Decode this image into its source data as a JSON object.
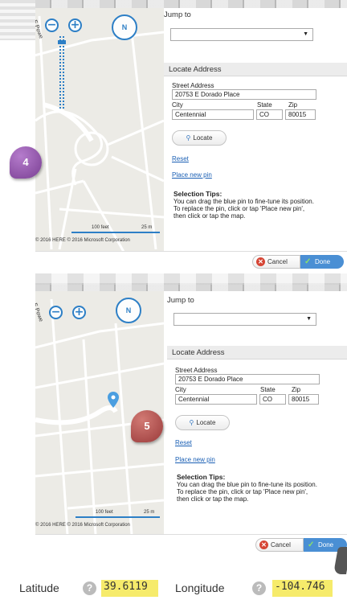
{
  "panel": {
    "jump_to": "Jump to",
    "locate_address": "Locate Address",
    "street_label": "Street Address",
    "street_value": "20753 E Dorado Place",
    "city_label": "City",
    "city_value": "Centennial",
    "state_label": "State",
    "state_value": "CO",
    "zip_label": "Zip",
    "zip_value": "80015",
    "locate_button": "Locate",
    "reset_link": "Reset",
    "place_pin_link": "Place new pin",
    "tips_title": "Selection Tips:",
    "tips_text": "You can drag the blue pin to fine-tune its position. To replace the pin, click or tap 'Place new pin', then click or tap the map.",
    "cancel_button": "Cancel",
    "done_button": "Done"
  },
  "map": {
    "compass_label": "N",
    "zoom_in": "+",
    "zoom_out": "−",
    "scale_feet": "100 feet",
    "scale_m": "25 m",
    "copyright": "© 2016 HERE  © 2016 Microsoft Corporation",
    "street_fragment": "E Powe"
  },
  "steps": {
    "step4": "4",
    "step5": "5",
    "step4_color": "#8a4fa0",
    "step5_color": "#b24a4a"
  },
  "coords": {
    "latitude_label": "Latitude",
    "latitude_value": "39.6119",
    "longitude_label": "Longitude",
    "longitude_value": "-104.746"
  },
  "colors": {
    "accent": "#2d7fc6",
    "done": "#4a8fd4",
    "highlight": "#f6eb6b"
  }
}
